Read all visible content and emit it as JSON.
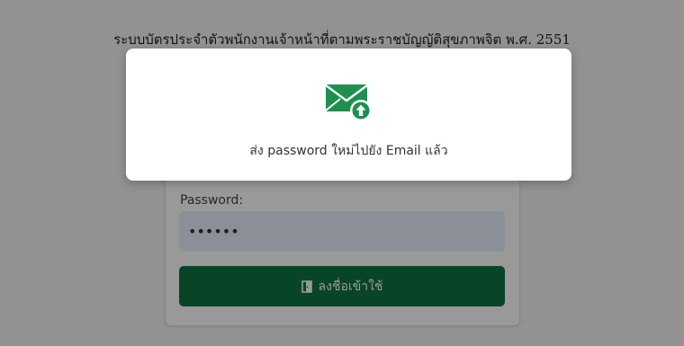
{
  "page": {
    "system_title": "ระบบบัตรประจำตัวพนักงานเจ้าหน้าที่ตามพระราชบัญญัติสุขภาพจิต พ.ศ. 2551"
  },
  "login_form": {
    "password_label": "Password:",
    "password_value": "••••••",
    "login_button_label": "ลงชื่อเข้าใช้",
    "login_icon": "door-enter-icon"
  },
  "modal": {
    "icon": "mail-upload-icon",
    "message": "ส่ง password ใหม่ไปยัง Email แล้ว"
  },
  "colors": {
    "brand_green": "#0d7340",
    "icon_green": "#1e8f4f",
    "input_fill": "#e8f0fe",
    "overlay": "rgba(0,0,0,0.40)"
  }
}
